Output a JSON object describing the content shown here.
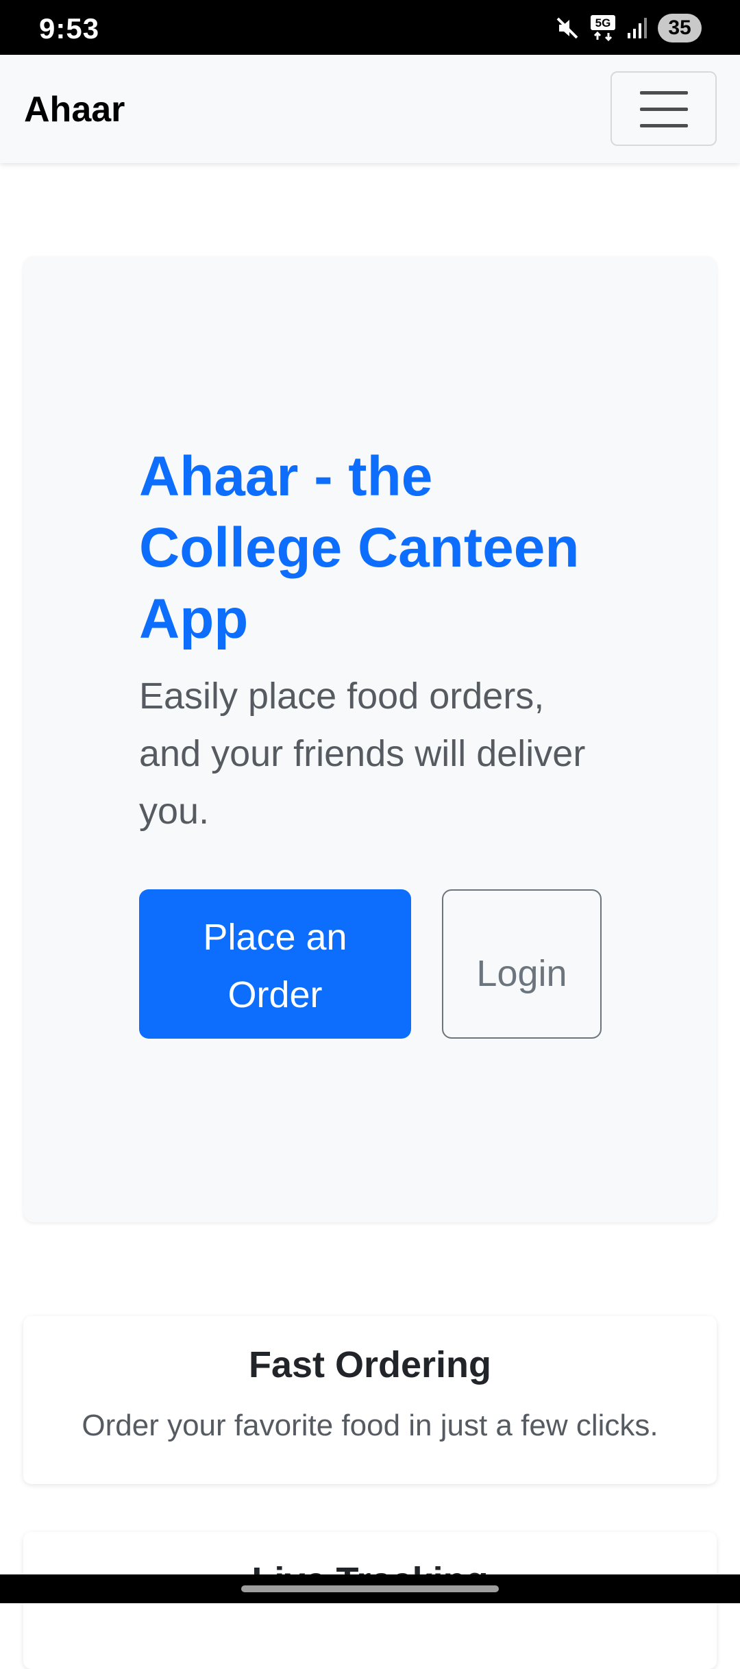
{
  "status_bar": {
    "time": "9:53",
    "battery": "35",
    "network_label": "5G",
    "icons": [
      "mute-icon",
      "network-5g-icon",
      "signal-icon",
      "battery-icon"
    ]
  },
  "navbar": {
    "brand": "Ahaar",
    "menu_icon": "hamburger-menu-icon"
  },
  "hero": {
    "title": "Ahaar - the College Canteen App",
    "lead": "Easily place food orders, and your friends will deliver you.",
    "primary_button": "Place an Order",
    "secondary_button": "Login"
  },
  "features": [
    {
      "title": "Fast Ordering",
      "text": "Order your favorite food in just a few clicks."
    },
    {
      "title": "Live Tracking"
    }
  ],
  "colors": {
    "primary": "#0d6efd",
    "navbar_bg": "#f8f9fa",
    "hero_bg": "#f8f9fa",
    "secondary": "#6c757d"
  }
}
